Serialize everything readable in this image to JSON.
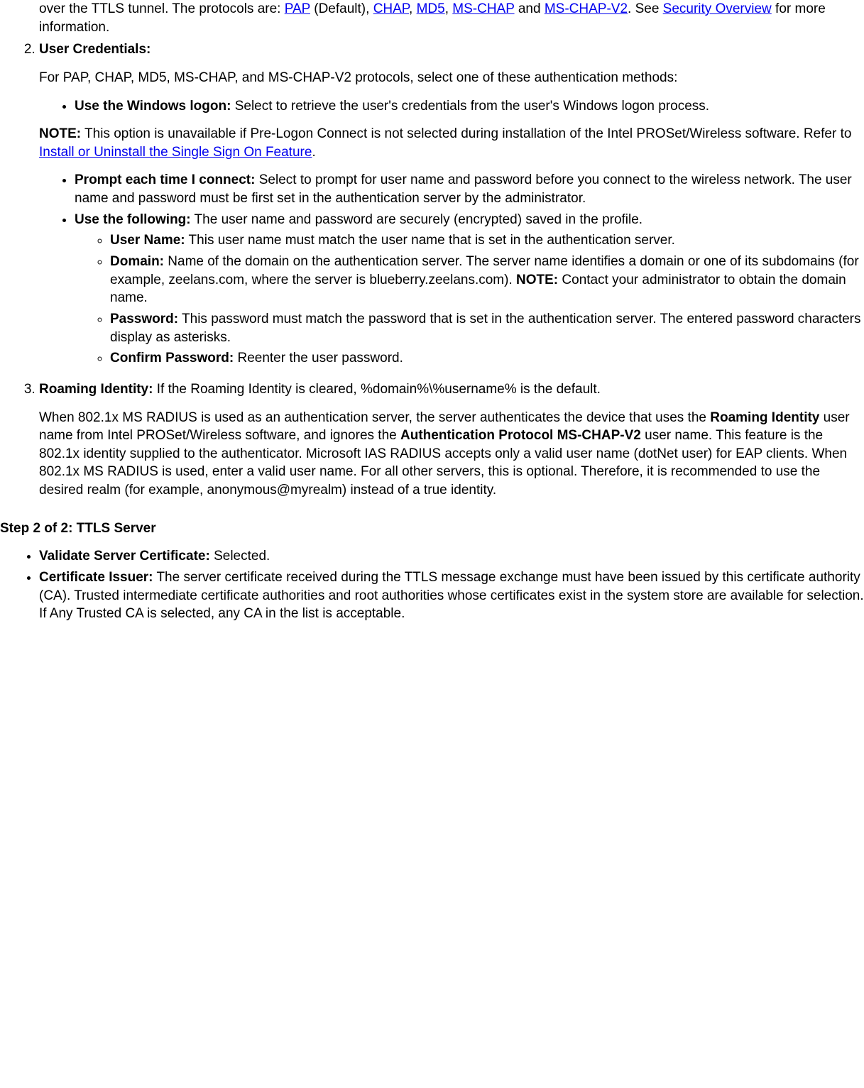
{
  "frag1_pre": "over the TTLS tunnel. The protocols are: ",
  "link_pap": "PAP",
  "frag1_mid1": " (Default), ",
  "link_chap": "CHAP",
  "frag1_mid2": ", ",
  "link_md5": "MD5",
  "frag1_mid3": ", ",
  "link_mschap": "MS-CHAP",
  "frag1_mid4": " and ",
  "link_mschapv2": "MS-CHAP-V2",
  "frag1_mid5": ". See ",
  "link_security": "Security Overview",
  "frag1_end": " for more information.",
  "item2_title": "User Credentials:",
  "item2_p1": "For PAP, CHAP, MD5, MS-CHAP, and MS-CHAP-V2 protocols, select one of these authentication methods:",
  "item2_b1_bold": "Use the Windows logon:",
  "item2_b1_text": " Select to retrieve the user's credentials from the user's Windows logon process.",
  "note_label": "NOTE:",
  "note_text1": " This option is unavailable if Pre-Logon Connect is not selected during installation of the Intel PROSet/Wireless software. Refer to ",
  "link_install": "Install or Uninstall the Single Sign On Feature",
  "note_text2": ".",
  "item2_b2_bold": "Prompt each time I connect:",
  "item2_b2_text": " Select to prompt for user name and password before you connect to the wireless network. The user name and password must be first set in the authentication server by the administrator.",
  "item2_b3_bold": "Use the following:",
  "item2_b3_text": " The user name and password are securely (encrypted) saved in the profile.",
  "sub1_bold": "User Name:",
  "sub1_text": " This user name must match the user name that is set in the authentication server.",
  "sub2_bold": "Domain:",
  "sub2_text": " Name of the domain on the authentication server. The server name identifies a domain or one of its subdomains (for example, zeelans.com, where the server is blueberry.zeelans.com). ",
  "sub2_note_bold": "NOTE:",
  "sub2_note_text": " Contact your administrator to obtain the domain name.",
  "sub3_bold": "Password:",
  "sub3_text": " This password must match the password that is set in the authentication server. The entered password characters display as asterisks.",
  "sub4_bold": "Confirm Password:",
  "sub4_text": " Reenter the user password.",
  "item3_bold": "Roaming Identity:",
  "item3_text1": " If the Roaming Identity is cleared, %domain%\\%username% is the default.",
  "item3_p2a": "When 802.1x MS RADIUS is used as an authentication server, the server authenticates the device that uses the ",
  "item3_p2b_bold": "Roaming Identity",
  "item3_p2c": " user name from Intel PROSet/Wireless software, and ignores the ",
  "item3_p2d_bold": "Authentication Protocol MS-CHAP-V2",
  "item3_p2e": " user name. This feature is the 802.1x identity supplied to the authenticator. Microsoft IAS RADIUS accepts only a valid user name (dotNet user) for EAP clients. When 802.1x MS RADIUS is used, enter a valid user name. For all other servers, this is optional. Therefore, it is recommended to use the desired realm (for example, anonymous@myrealm) instead of a true identity.",
  "step2_heading": "Step 2 of 2: TTLS Server",
  "s2_b1_bold": "Validate Server Certificate:",
  "s2_b1_text": " Selected.",
  "s2_b2_bold": "Certificate Issuer:",
  "s2_b2_text": " The server certificate received during the TTLS message exchange must have been issued by this certificate authority (CA). Trusted intermediate certificate authorities and root authorities whose certificates exist in the system store are available for selection. If Any Trusted CA is selected, any CA in the list is acceptable."
}
